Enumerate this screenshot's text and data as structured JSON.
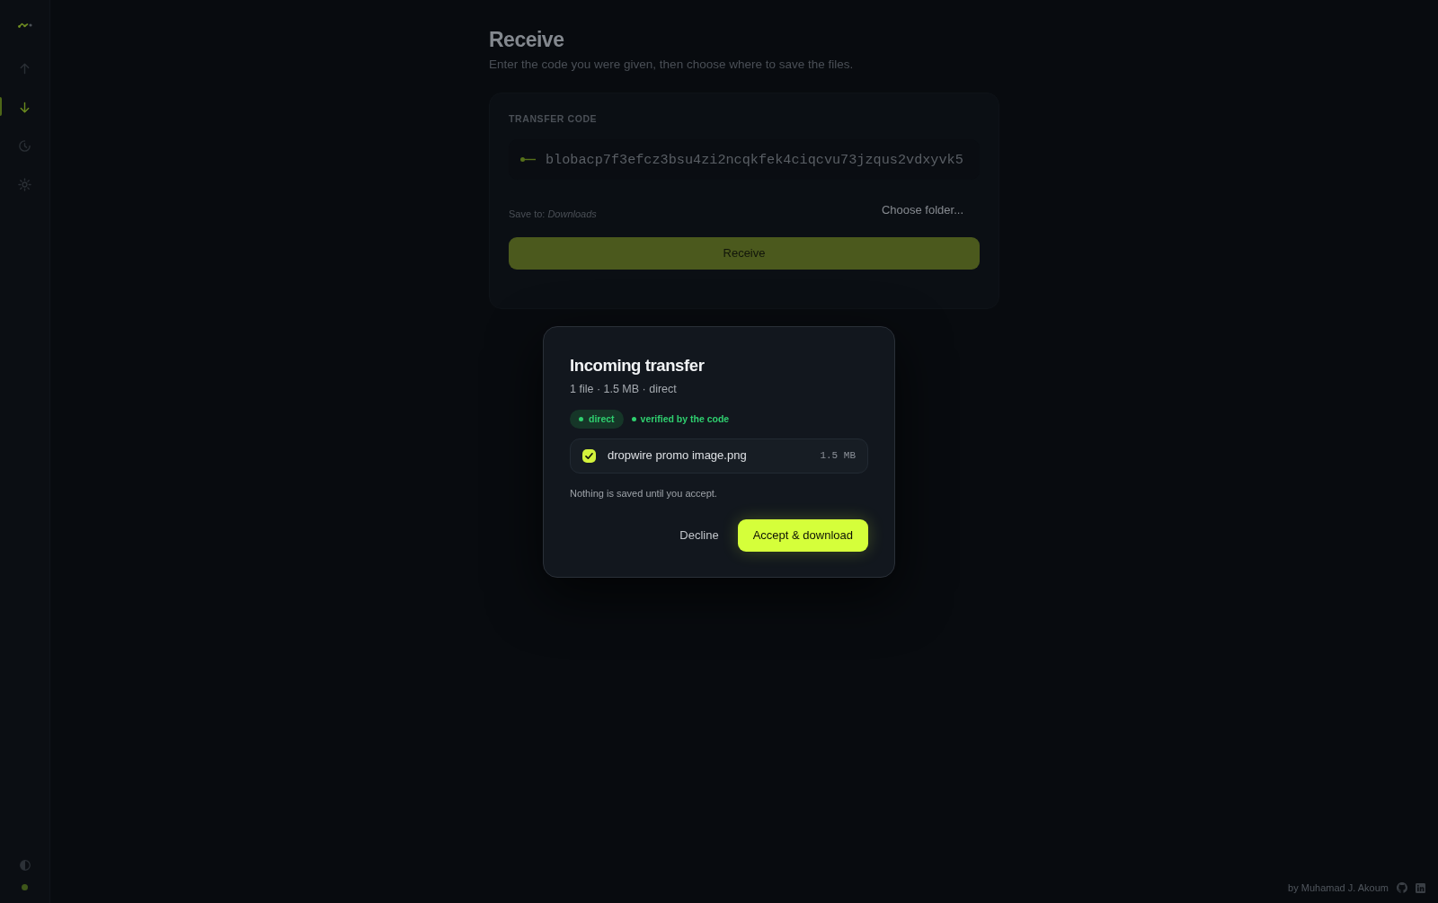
{
  "sidebar": {
    "nav_items": [
      {
        "kind": "up",
        "selected": false
      },
      {
        "kind": "down",
        "selected": true
      },
      {
        "kind": "clock",
        "selected": false
      },
      {
        "kind": "sun",
        "selected": false
      }
    ]
  },
  "page": {
    "title": "Receive",
    "subtitle": "Enter the code you were given, then choose where to save the files."
  },
  "transfer_card": {
    "label": "TRANSFER CODE",
    "code_field": {
      "value": "blobacp7f3efcz3bsu4zi2ncqkfek4ciqcvu73jzqus2vdxyvk5"
    },
    "save_to": "Save to: *Downloads*",
    "choose_folder_button": "Choose folder...",
    "receive_button": "Receive"
  },
  "modal": {
    "title": "Incoming transfer",
    "summary": "1 file · 1.5 MB · direct",
    "badges": [
      {
        "kind": "pill",
        "label": "direct"
      },
      {
        "kind": "plain",
        "label": "verified by the code"
      }
    ],
    "files": [
      {
        "name": "dropwire promo image.png",
        "size": "1.5 MB",
        "checked": true
      }
    ],
    "note": "Nothing is saved until you accept.",
    "buttons": [
      {
        "kind": "secondary",
        "label": "Decline"
      },
      {
        "kind": "primary",
        "label": "Accept & download"
      }
    ]
  },
  "footer": {
    "credit": "by Muhamad J. Akoum"
  }
}
